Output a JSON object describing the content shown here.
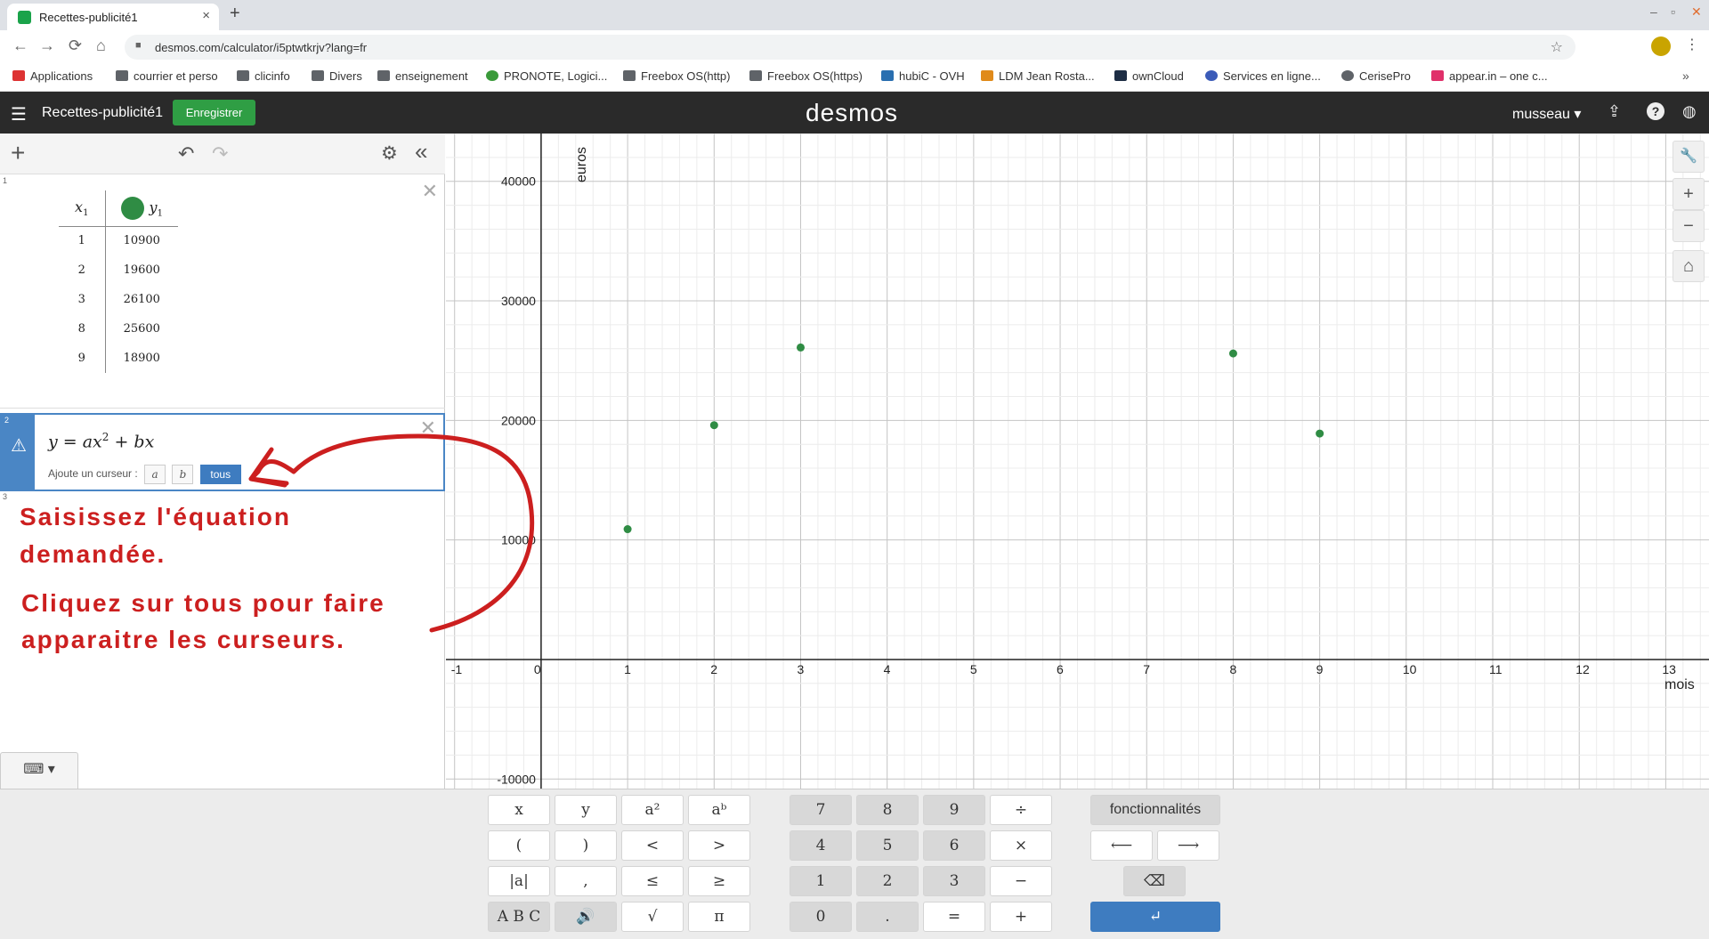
{
  "browser": {
    "tab_title": "Recettes-publicité1",
    "close_glyph": "×",
    "newtab_glyph": "+",
    "url": "desmos.com/calculator/i5ptwtkrjv?lang=fr",
    "back": "←",
    "forward": "→",
    "reload": "⟳",
    "home": "⌂",
    "window": {
      "minimize": "–",
      "restore": "▫",
      "close": "✕"
    },
    "bookmarks": [
      "Applications",
      "courrier et perso",
      "clicinfo",
      "Divers",
      "enseignement",
      "PRONOTE, Logici...",
      "Freebox OS(http)",
      "Freebox OS(https)",
      "hubiC - OVH",
      "LDM Jean Rosta...",
      "ownCloud",
      "Services en ligne...",
      "CerisePro",
      "appear.in – one c..."
    ],
    "bookmarks_more": "»"
  },
  "desmos": {
    "graph_title": "Recettes-publicité1",
    "save_label": "Enregistrer",
    "logo": "desmos",
    "user": "musseau ▾",
    "icons": {
      "menu": "☰",
      "share": "⇪",
      "help": "?",
      "lang": "◍"
    }
  },
  "panel": {
    "add": "+",
    "undo": "↶",
    "redo": "↷",
    "settings": "⚙",
    "collapse": "«",
    "row_numbers": [
      "1",
      "2",
      "3"
    ],
    "table": {
      "col1_name": "x",
      "col1_sub": "1",
      "col2_name": "y",
      "col2_sub": "1",
      "rows": [
        [
          "1",
          "10900"
        ],
        [
          "2",
          "19600"
        ],
        [
          "3",
          "26100"
        ],
        [
          "8",
          "25600"
        ],
        [
          "9",
          "18900"
        ]
      ]
    },
    "expression": {
      "lhs": "y = ax",
      "exp": "2",
      "rhs": " + bx",
      "slider_prompt": "Ajoute un curseur :",
      "slider_buttons": [
        "a",
        "b",
        "tous"
      ]
    },
    "close": "✕",
    "warning": "⚠",
    "zoom_fit": "⊕",
    "keyboard_toggle": "⌨ ▾"
  },
  "annotations": {
    "line1": "Saisissez l'équation demandée.",
    "line2": "Cliquez sur tous pour faire",
    "line3": "apparaitre les curseurs.",
    "color": "#cc1f1f"
  },
  "graph_tools": {
    "wrench": "🔧",
    "zoom_in": "+",
    "zoom_out": "−",
    "home": "⌂"
  },
  "chart_data": {
    "type": "scatter",
    "xlabel": "mois",
    "ylabel": "euros",
    "xlim": [
      -1.1,
      13.5
    ],
    "ylim": [
      -10800,
      44000
    ],
    "x_ticks": [
      -1,
      0,
      1,
      2,
      3,
      4,
      5,
      6,
      7,
      8,
      9,
      10,
      11,
      12,
      13
    ],
    "y_ticks": [
      -10000,
      10000,
      20000,
      30000,
      40000
    ],
    "grid": true,
    "point_color": "#2f8c44",
    "points": [
      {
        "x": 1,
        "y": 10900
      },
      {
        "x": 2,
        "y": 19600
      },
      {
        "x": 3,
        "y": 26100
      },
      {
        "x": 8,
        "y": 25600
      },
      {
        "x": 9,
        "y": 18900
      }
    ]
  },
  "keypad": {
    "left": [
      "x",
      "y",
      "a²",
      "aᵇ",
      "(",
      ")",
      "<",
      ">",
      "|a|",
      ",",
      "≤",
      "≥",
      "A B C",
      "🔊",
      "√",
      "π"
    ],
    "num": [
      "7",
      "8",
      "9",
      "÷",
      "4",
      "5",
      "6",
      "×",
      "1",
      "2",
      "3",
      "−",
      "0",
      ".",
      "=",
      "+"
    ],
    "func_label": "fonctionnalités",
    "left_arrow": "⟵",
    "right_arrow": "⟶",
    "backspace": "⌫",
    "enter": "↵"
  }
}
